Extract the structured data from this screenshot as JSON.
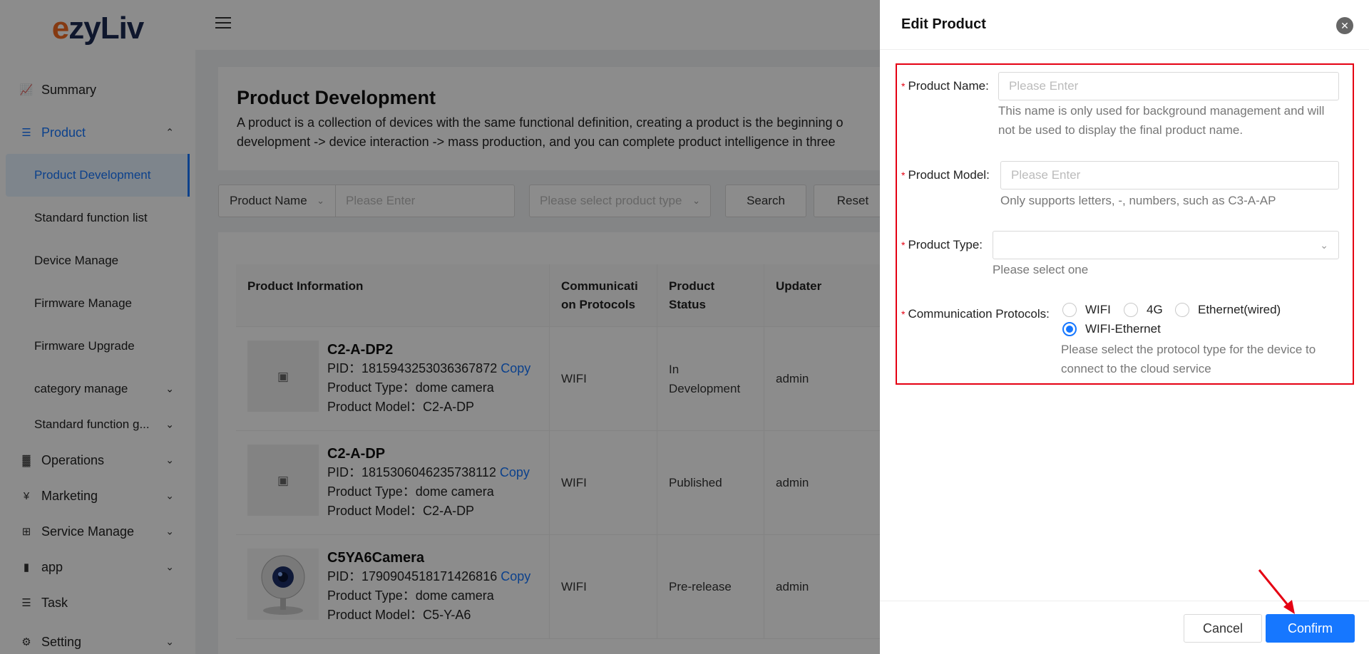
{
  "logo": {
    "part1": "e",
    "part2": "zyLiv"
  },
  "sidebar": {
    "items": [
      {
        "label": "Summary",
        "icon": "chart-icon"
      },
      {
        "label": "Product",
        "icon": "document-icon"
      },
      {
        "label": "Operations",
        "icon": "bar-chart-icon"
      },
      {
        "label": "Marketing",
        "icon": "yen-circle-icon"
      },
      {
        "label": "Service Manage",
        "icon": "grid-icon"
      },
      {
        "label": "app",
        "icon": "phone-icon"
      },
      {
        "label": "Task",
        "icon": "list-icon"
      },
      {
        "label": "Setting",
        "icon": "gear-icon"
      }
    ],
    "product_sub": [
      {
        "label": "Product Development"
      },
      {
        "label": "Standard function list"
      },
      {
        "label": "Device Manage"
      },
      {
        "label": "Firmware Manage"
      },
      {
        "label": "Firmware Upgrade"
      },
      {
        "label": "category manage"
      },
      {
        "label": "Standard function g..."
      }
    ]
  },
  "page": {
    "title": "Product Development",
    "desc1": "A product is a collection of devices with the same functional definition, creating a product is the beginning o",
    "desc2": "development -> device interaction -> mass production, and you can complete product intelligence in three"
  },
  "filters": {
    "name_select": "Product Name",
    "name_placeholder": "Please Enter",
    "type_placeholder": "Please select product type",
    "search": "Search",
    "reset": "Reset"
  },
  "table": {
    "headers": [
      "Product Information",
      "Communicati\non Protocols",
      "Product\nStatus",
      "Updater"
    ],
    "rows": [
      {
        "name": "C2-A-DP2",
        "pid": "PID：1815943253036367872",
        "type": "Product Type：dome camera",
        "model": "Product Model：C2-A-DP",
        "protocol": "WIFI",
        "status": "In Development",
        "updater": "admin"
      },
      {
        "name": "C2-A-DP",
        "pid": "PID：1815306046235738112",
        "type": "Product Type：dome camera",
        "model": "Product Model：C2-A-DP",
        "protocol": "WIFI",
        "status": "Published",
        "updater": "admin"
      },
      {
        "name": "C5YA6Camera",
        "pid": "PID：1790904518171426816",
        "type": "Product Type：dome camera",
        "model": "Product Model：C5-Y-A6",
        "protocol": "WIFI",
        "status": "Pre-release",
        "updater": "admin"
      }
    ],
    "copy_label": "Copy"
  },
  "drawer": {
    "title": "Edit Product",
    "name_label": "Product Name:",
    "name_placeholder": "Please Enter",
    "name_help1": "This name is only used for background management and will",
    "name_help2": "not be used to display the final product name.",
    "model_label": "Product Model:",
    "model_placeholder": "Please Enter",
    "model_help": "Only supports letters, -, numbers, such as C3-A-AP",
    "type_label": "Product Type:",
    "type_help": "Please select one",
    "protocol_label": "Communication Protocols:",
    "protocols": [
      "WIFI",
      "4G",
      "Ethernet(wired)",
      "WIFI-Ethernet"
    ],
    "protocol_selected": "WIFI-Ethernet",
    "protocol_help1": "Please select the protocol type for the device to",
    "protocol_help2": "connect to the cloud service",
    "cancel": "Cancel",
    "confirm": "Confirm"
  },
  "colors": {
    "primary": "#1677ff",
    "highlight": "#e50012",
    "mask": "rgba(0,0,0,0.45)"
  }
}
